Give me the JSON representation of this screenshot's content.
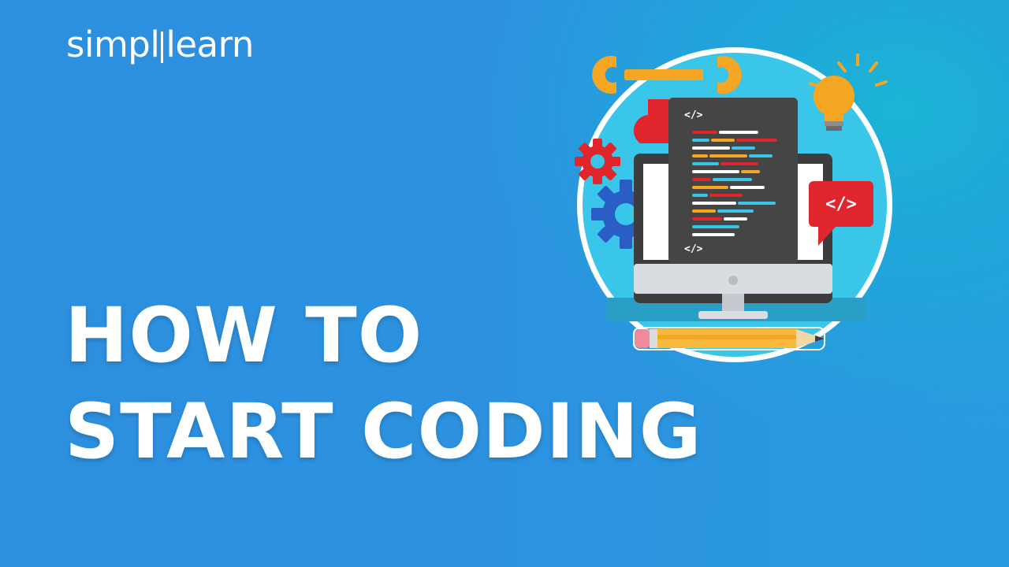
{
  "brand": {
    "name_part1": "simpl",
    "name_part2": "learn"
  },
  "headline": {
    "line1": "HOW TO",
    "line2": "START CODING"
  },
  "illustration": {
    "code_tag": "</>",
    "colors": {
      "circle": "#39c6e8",
      "monitor_frame": "#d9dde2",
      "screen": "#454545",
      "accent_red": "#e0252c",
      "accent_orange": "#f5a623",
      "gear_blue": "#2b5dc7",
      "pencil_body": "#f8b93c",
      "pencil_eraser": "#f08a9a"
    }
  }
}
